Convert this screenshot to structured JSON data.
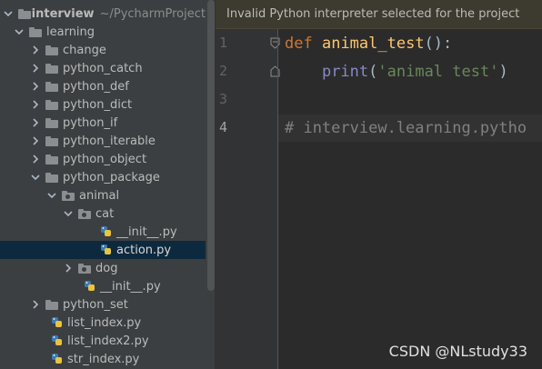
{
  "project_tree": {
    "root": {
      "name": "interview",
      "path": "~/PycharmProject"
    },
    "items": [
      {
        "label": "learning",
        "type": "folder",
        "expanded": true
      },
      {
        "label": "change",
        "type": "folder",
        "expanded": false
      },
      {
        "label": "python_catch",
        "type": "folder",
        "expanded": false
      },
      {
        "label": "python_def",
        "type": "folder",
        "expanded": false
      },
      {
        "label": "python_dict",
        "type": "folder",
        "expanded": false
      },
      {
        "label": "python_if",
        "type": "folder",
        "expanded": false
      },
      {
        "label": "python_iterable",
        "type": "folder",
        "expanded": false
      },
      {
        "label": "python_object",
        "type": "folder",
        "expanded": false
      },
      {
        "label": "python_package",
        "type": "folder",
        "expanded": true
      },
      {
        "label": "animal",
        "type": "package",
        "expanded": true
      },
      {
        "label": "cat",
        "type": "package",
        "expanded": true
      },
      {
        "label": "__init__.py",
        "type": "python-file"
      },
      {
        "label": "action.py",
        "type": "python-file",
        "selected": true
      },
      {
        "label": "dog",
        "type": "package",
        "expanded": false
      },
      {
        "label": "__init__.py",
        "type": "python-file"
      },
      {
        "label": "python_set",
        "type": "folder",
        "expanded": false
      },
      {
        "label": "list_index.py",
        "type": "python-file"
      },
      {
        "label": "list_index2.py",
        "type": "python-file"
      },
      {
        "label": "str_index.py",
        "type": "python-file"
      }
    ]
  },
  "editor": {
    "banner": "Invalid Python interpreter selected for the project",
    "line_numbers": [
      "1",
      "2",
      "3",
      "4"
    ],
    "code": {
      "line1": {
        "kw": "def",
        "fn": "animal_test",
        "rest": "():"
      },
      "line2": {
        "builtin": "print",
        "open": "(",
        "str": "'animal test'",
        "close": ")"
      },
      "line3": "",
      "line4": "# interview.learning.pytho"
    }
  },
  "watermark": "CSDN @NLstudy33",
  "colors": {
    "keyword": "#cc7832",
    "function": "#ffc66d",
    "builtin": "#8888c6",
    "string": "#6a8759",
    "comment": "#808080",
    "selection": "#0d293e"
  }
}
